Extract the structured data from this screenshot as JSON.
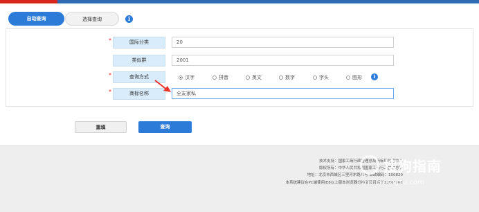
{
  "tabs": {
    "auto_query": "自动查询",
    "select_query": "选择查询"
  },
  "form": {
    "intl_class": {
      "label": "国际分类",
      "value": "20"
    },
    "similar_group": {
      "label": "类似群",
      "value": "2001"
    },
    "query_method": {
      "label": "查询方式",
      "options": [
        "汉字",
        "拼音",
        "英文",
        "数字",
        "字头",
        "图形"
      ],
      "selected": "汉字"
    },
    "trademark_name": {
      "label": "商标名称",
      "value": "全友家私"
    }
  },
  "buttons": {
    "reset": "重填",
    "search": "查询"
  },
  "footer": {
    "line1": "技术支持：国家工商行政管理总局商标局信息中心",
    "line2": "版权所有：中华人民共和国国家工商行政管理总局",
    "line3": "地址：北京市西城区三里河东路八号  邮政编码：100820",
    "line4": "本系统建议在PC端使用IE8以上版本浏览器分辨率设置高于1366*768"
  },
  "watermark": {
    "name": "搜狗指南",
    "url": "zhinan.sogou.com"
  },
  "colors": {
    "primary": "#2c7bd9",
    "header_bar": "#2f6bb3",
    "header_accent": "#d9261c",
    "label_bg": "#d9ecfb",
    "required": "#ee2233",
    "arrow": "#e8342a"
  }
}
